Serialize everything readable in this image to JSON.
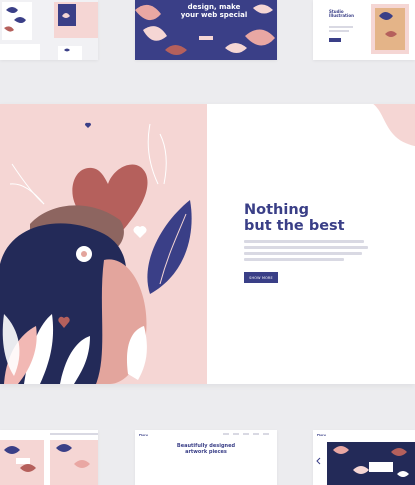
{
  "top_row": {
    "t2_banner_text": "design, make your web special",
    "t3_title": "Studio Illustration"
  },
  "hero": {
    "headline_line1": "Nothing",
    "headline_line2": "but the best",
    "cta_label": "SHOW MORE"
  },
  "bottom_row": {
    "b2_logo": "Floru",
    "b2_title_line1": "Beautifully designed",
    "b2_title_line2": "artwork pieces",
    "b3_logo": "Floru"
  },
  "colors": {
    "navy": "#3a3f87",
    "pink": "#f5d6d4",
    "rose": "#b5605c",
    "page_bg": "#ececef"
  }
}
